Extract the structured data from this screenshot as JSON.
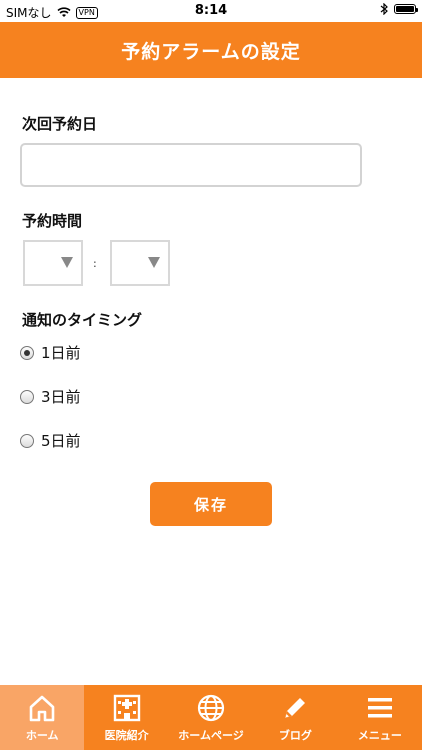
{
  "status_bar": {
    "carrier": "SIMなし",
    "vpn": "VPN",
    "time": "8:14"
  },
  "header": {
    "title": "予約アラームの設定"
  },
  "form": {
    "next_date_label": "次回予約日",
    "next_date_value": "",
    "time_label": "予約時間",
    "hour_value": "",
    "minute_value": "",
    "time_separator": ":",
    "timing_label": "通知のタイミング",
    "options": [
      {
        "label": "1日前",
        "checked": true
      },
      {
        "label": "3日前",
        "checked": false
      },
      {
        "label": "5日前",
        "checked": false
      }
    ],
    "save_label": "保存"
  },
  "tabs": [
    {
      "label": "ホーム",
      "icon": "home-icon",
      "active": true
    },
    {
      "label": "医院紹介",
      "icon": "hospital-icon",
      "active": false
    },
    {
      "label": "ホームページ",
      "icon": "globe-icon",
      "active": false
    },
    {
      "label": "ブログ",
      "icon": "pencil-icon",
      "active": false
    },
    {
      "label": "メニュー",
      "icon": "hamburger-menu-icon",
      "active": false
    }
  ],
  "colors": {
    "accent": "#f6821f",
    "active_tab": "#f9a566"
  }
}
